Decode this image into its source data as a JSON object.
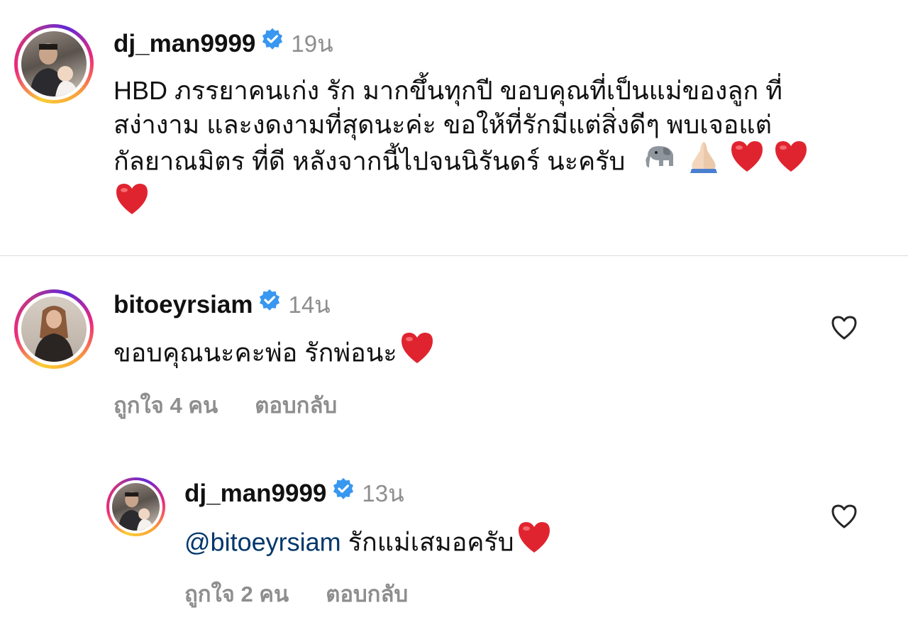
{
  "post": {
    "username": "dj_man9999",
    "time": "19น",
    "verified": true,
    "caption_lines": [
      "HBD ภรรยาคนเก่ง รัก มากขึ้นทุกปี ขอบคุณที่เป็นแม่ของลูก ที่",
      "สง่างาม และงดงามที่สุดนะค่ะ ขอให้ที่รักมีแต่สิ่งดีๆ พบเจอแต่",
      "กัลยาณมิตร ที่ดี หลังจากนี้ไปจนนิรันดร์ นะครับ"
    ],
    "caption_emojis": [
      "elephant",
      "folded-hands",
      "red-heart",
      "red-heart",
      "red-heart"
    ]
  },
  "comments": [
    {
      "username": "bitoeyrsiam",
      "time": "14น",
      "verified": true,
      "text": "ขอบคุณนะคะพ่อ รักพ่อนะ",
      "likes": "ถูกใจ 4 คน",
      "reply": "ตอบกลับ"
    }
  ],
  "replies": [
    {
      "username": "dj_man9999",
      "time": "13น",
      "verified": true,
      "mention": "@bitoeyrsiam",
      "text": "รักแม่เสมอครับ",
      "likes": "ถูกใจ 2 คน",
      "reply": "ตอบกลับ"
    }
  ],
  "colors": {
    "verified_blue": "#3897f0",
    "mention": "#00376b",
    "meta_gray": "#8e8e8e",
    "heart_red": "#e0242f"
  }
}
